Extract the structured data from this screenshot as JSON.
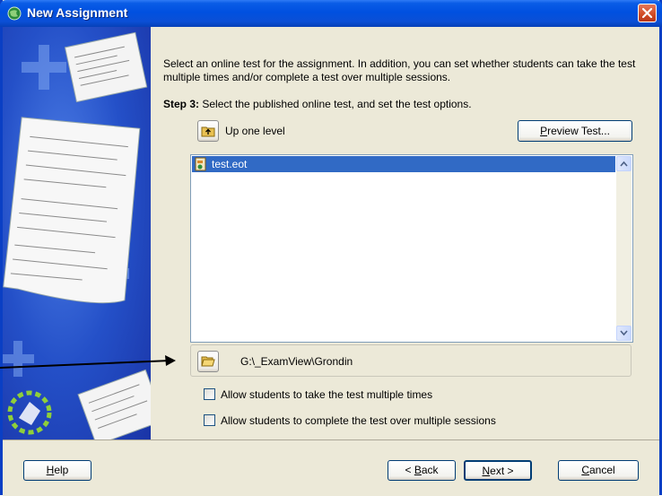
{
  "window": {
    "title": "New Assignment"
  },
  "intro": "Select an online test for the assignment. In addition, you can set whether students can take the test multiple times and/or complete a test over multiple sessions.",
  "step": {
    "label": "Step 3:",
    "text": "Select the published online test, and set the test options."
  },
  "navigation": {
    "up_label": "Up one level",
    "preview_button": {
      "before": "",
      "accel": "P",
      "after": "review Test..."
    }
  },
  "file_list": {
    "items": [
      {
        "label": "test.eot",
        "icon": "test-file-icon",
        "selected": true
      }
    ]
  },
  "path": {
    "folder_icon": "folder-open-icon",
    "text": "G:\\_ExamView\\Grondin"
  },
  "options": [
    {
      "label": "Allow students to take the test multiple times",
      "checked": false
    },
    {
      "label": "Allow students to complete the test over multiple sessions",
      "checked": false
    }
  ],
  "footer": {
    "help": {
      "before": "",
      "accel": "H",
      "after": "elp"
    },
    "back": {
      "before": "< ",
      "accel": "B",
      "after": "ack"
    },
    "next": {
      "before": "",
      "accel": "N",
      "after": "ext >"
    },
    "cancel": {
      "before": "",
      "accel": "C",
      "after": "ancel"
    }
  },
  "colors": {
    "title_bar": "#0050e0",
    "selection": "#316ac5",
    "dialog_bg": "#ece9d8",
    "close_button": "#d04a24"
  }
}
